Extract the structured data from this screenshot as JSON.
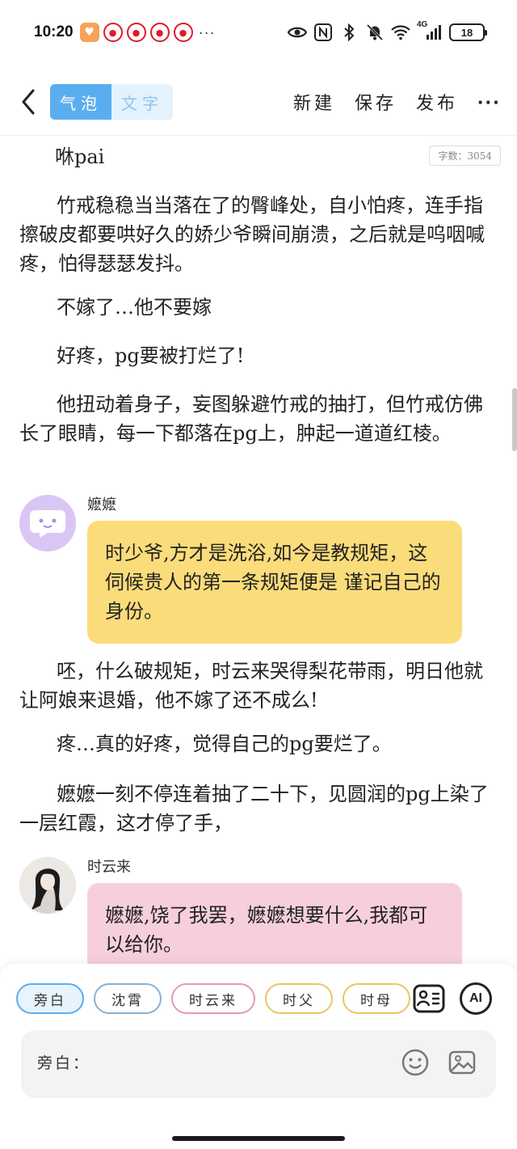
{
  "status_bar": {
    "time": "10:20",
    "more": "···",
    "network": "4G",
    "battery": "18",
    "icons": [
      "heart-app-icon",
      "weibo-icon",
      "weibo-icon",
      "weibo-icon",
      "weibo-icon",
      "eye-icon",
      "nfc-icon",
      "bluetooth-icon",
      "bell-off-icon",
      "wifi-icon",
      "signal-icon",
      "battery-icon"
    ]
  },
  "toolbar": {
    "tabs": [
      {
        "label": "气泡",
        "active": true
      },
      {
        "label": "文字",
        "active": false
      }
    ],
    "new_label": "新建",
    "save_label": "保存",
    "publish_label": "发布",
    "more_label": "···"
  },
  "document": {
    "word_count": "字数：3054",
    "paragraphs": [
      "咻pai",
      "竹戒稳稳当当落在了的臀峰处，自小怕疼，连手指擦破皮都要哄好久的娇少爷瞬间崩溃，之后就是呜咽喊疼，怕得瑟瑟发抖。",
      "不嫁了…他不要嫁",
      "好疼，pg要被打烂了!",
      "他扭动着身子，妄图躲避竹戒的抽打，但竹戒仿佛长了眼睛，每一下都落在pg上，肿起一道道红棱。",
      "呸，什么破规矩，时云来哭得梨花带雨，明日他就让阿娘来退婚，他不嫁了还不成么!",
      "疼…真的好疼，觉得自己的pg要烂了。",
      "嬷嬷一刻不停连着抽了二十下，见圆润的pg上染了一层红霞，这才停了手，"
    ],
    "bubbles": [
      {
        "speaker": "嬷嬷",
        "text": "时少爷,方才是洗浴,如今是教规矩，这伺候贵人的第一条规矩便是 谨记自己的身份。",
        "color": "#fbdc7a"
      },
      {
        "speaker": "时云来",
        "text": "嬷嬷,饶了我罢，嬷嬷想要什么,我都可以给你。",
        "color": "#f7cfdc"
      }
    ]
  },
  "bottom": {
    "roles": [
      "旁白",
      "沈霄",
      "时云来",
      "时父",
      "时母"
    ],
    "selected_role": "旁白",
    "ai_label": "AI",
    "input_prefix": "旁白：",
    "input_value": ""
  }
}
